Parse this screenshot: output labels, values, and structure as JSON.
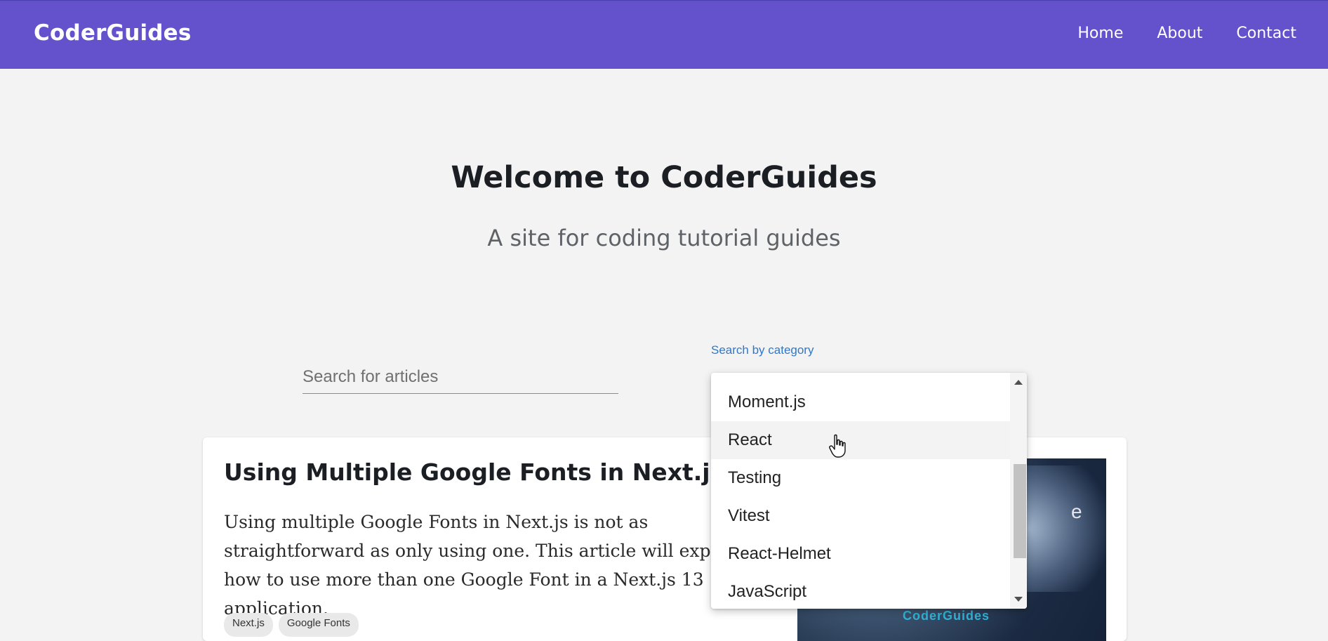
{
  "header": {
    "brand": "CoderGuides",
    "nav": [
      "Home",
      "About",
      "Contact"
    ]
  },
  "hero": {
    "title": "Welcome to CoderGuides",
    "subtitle": "A site for coding tutorial guides"
  },
  "search": {
    "placeholder": "Search for articles",
    "value": ""
  },
  "category": {
    "label": "Search by category",
    "options": [
      "Moment.js",
      "React",
      "Testing",
      "Vitest",
      "React-Helmet",
      "JavaScript"
    ],
    "hovered": "React"
  },
  "article": {
    "title": "Using Multiple Google Fonts in Next.js 13",
    "description": "Using multiple Google Fonts in Next.js is not as straightforward as only using one. This article will explain how to use more than one Google Font in a Next.js 13 application.",
    "tags": [
      "Next.js",
      "Google Fonts"
    ],
    "image_brand": "CoderGuides",
    "image_partial_text": "e"
  },
  "colors": {
    "header_bg": "#6352cc",
    "page_bg": "#f3f3f3",
    "label_blue": "#2f78c9"
  }
}
